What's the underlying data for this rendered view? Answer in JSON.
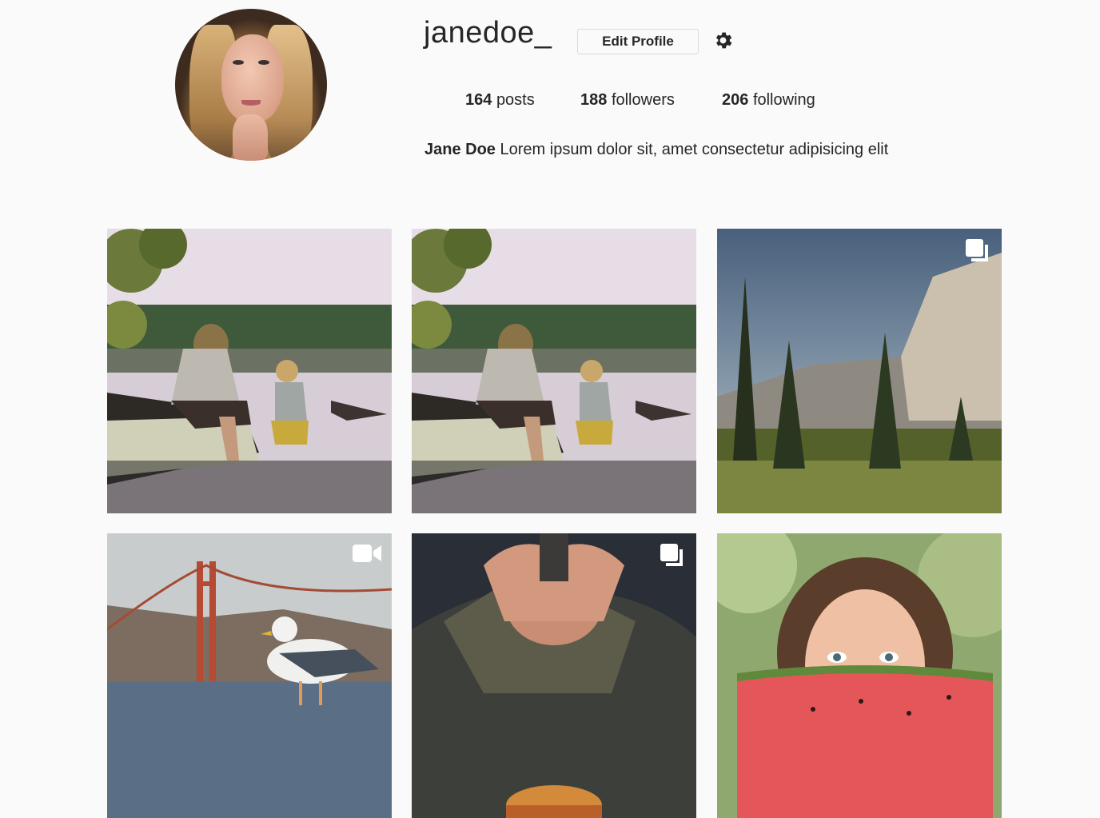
{
  "profile": {
    "username": "janedoe_",
    "edit_label": "Edit Profile",
    "stats": [
      {
        "count": "164",
        "label": "posts"
      },
      {
        "count": "188",
        "label": "followers"
      },
      {
        "count": "206",
        "label": "following"
      }
    ],
    "bio_name": "Jane Doe",
    "bio_text": "Lorem ipsum dolor sit, amet consectetur adipisicing elit"
  },
  "posts": [
    {
      "subject": "mother-child-lake-photo",
      "badge": ""
    },
    {
      "subject": "mother-child-lake-photo",
      "badge": ""
    },
    {
      "subject": "mountain-forest-photo",
      "badge": "gallery-icon"
    },
    {
      "subject": "seagull-bridge-photo",
      "badge": "video-icon"
    },
    {
      "subject": "man-hands-burger-photo",
      "badge": "gallery-icon"
    },
    {
      "subject": "woman-watermelon-photo",
      "badge": ""
    }
  ]
}
